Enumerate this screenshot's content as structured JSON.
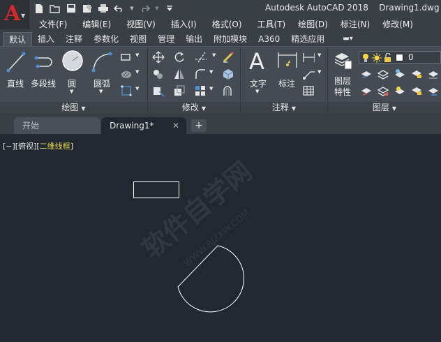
{
  "app": {
    "title": "Autodesk AutoCAD 2018",
    "document": "Drawing1.dwg",
    "logo_letter": "A"
  },
  "quick_access": [
    "new-icon",
    "open-icon",
    "save-icon",
    "save-as-icon",
    "plot-icon",
    "undo-icon",
    "redo-icon",
    "customize-icon"
  ],
  "menu": [
    "文件(F)",
    "编辑(E)",
    "视图(V)",
    "插入(I)",
    "格式(O)",
    "工具(T)",
    "绘图(D)",
    "标注(N)",
    "修改(M)"
  ],
  "ribbon_tabs": [
    "默认",
    "插入",
    "注释",
    "参数化",
    "视图",
    "管理",
    "输出",
    "附加模块",
    "A360",
    "精选应用",
    "▬▾"
  ],
  "panels": {
    "draw": {
      "title": "绘图",
      "line": "直线",
      "polyline": "多段线",
      "circle": "圆",
      "arc": "圆弧"
    },
    "modify": {
      "title": "修改"
    },
    "annotation": {
      "title": "注释",
      "text": "文字",
      "dimension": "标注"
    },
    "layers": {
      "title": "图层",
      "properties_line1": "图层",
      "properties_line2": "特性",
      "current_layer": "0"
    }
  },
  "doc_tabs": {
    "start": "开始",
    "drawing": "Drawing1*",
    "add": "+"
  },
  "viewport": {
    "prefix": "[−][俯视][",
    "style": "二维线框",
    "suffix": "]"
  },
  "watermark": {
    "main": "软件自学网",
    "url": "WWW.RJZXW.COM"
  },
  "colors": {
    "accent_red": "#d8282a",
    "visual_style_yellow": "#e8d24a",
    "canvas": "#212830"
  }
}
